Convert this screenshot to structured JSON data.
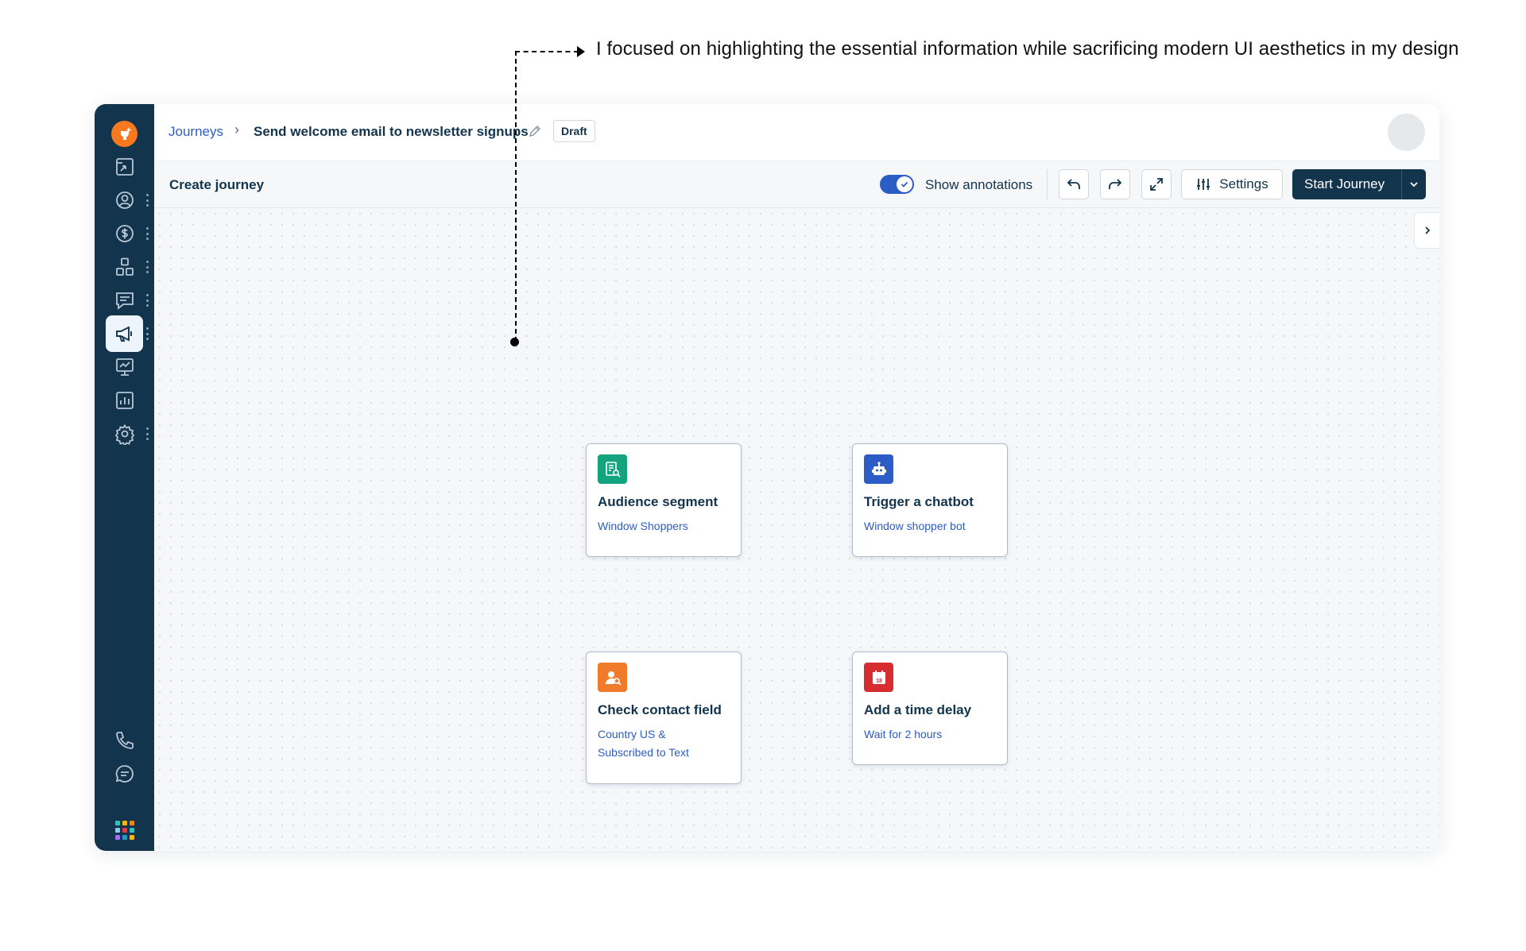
{
  "annotation": {
    "text": "I focused on highlighting the essential information while sacrificing modern UI aesthetics in my design"
  },
  "header": {
    "breadcrumb_root": "Journeys",
    "breadcrumb_separator": "›",
    "journey_name": "Send welcome email to newsletter signups",
    "status_badge": "Draft"
  },
  "toolbar": {
    "title": "Create journey",
    "annotations_toggle_label": "Show annotations",
    "annotations_toggle_on": true,
    "settings_label": "Settings",
    "start_label": "Start Journey"
  },
  "sidebar": {
    "items": [
      {
        "icon": "dashboard-icon"
      },
      {
        "icon": "contacts-icon"
      },
      {
        "icon": "deals-icon"
      },
      {
        "icon": "segments-icon"
      },
      {
        "icon": "conversations-icon"
      },
      {
        "icon": "campaigns-icon",
        "active": true
      },
      {
        "icon": "marketing-icon"
      },
      {
        "icon": "analytics-icon"
      },
      {
        "icon": "settings-icon"
      },
      {
        "icon": "phone-icon"
      },
      {
        "icon": "chat-icon"
      },
      {
        "icon": "apps-icon"
      }
    ]
  },
  "nodes": [
    {
      "title": "Audience segment",
      "subtitle": "Window Shoppers",
      "icon": "audience-segment-icon",
      "color": "#14a37f"
    },
    {
      "title": "Trigger a chatbot",
      "subtitle": "Window shopper bot",
      "icon": "chatbot-icon",
      "color": "#2c5cc5"
    },
    {
      "title": "Check contact field",
      "subtitle": "Country US & Subscribed to Text",
      "icon": "contact-field-icon",
      "color": "#f07c2b"
    },
    {
      "title": "Add a time delay",
      "subtitle": "Wait for 2 hours",
      "icon": "calendar-icon",
      "color": "#d72d30",
      "icon_text": "18"
    }
  ],
  "colors": {
    "sidebar_bg": "#13344d",
    "link_blue": "#2c5cc5",
    "primary_button": "#13344d",
    "logo_orange": "#f97a1e"
  }
}
